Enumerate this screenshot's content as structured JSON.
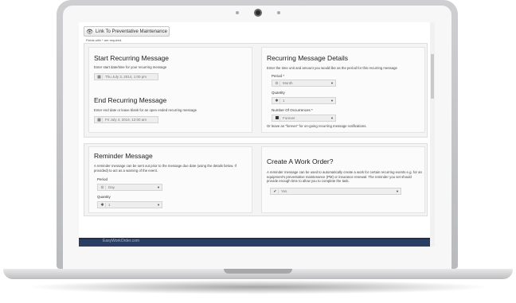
{
  "top_button": {
    "label": "Link To Preventative Maintenance",
    "icon": "eye-icon"
  },
  "required_note": "Fields with * are required.",
  "start": {
    "title": "Start Recurring Message",
    "help": "Enter start date/time for your recurring message",
    "value": "Thu July 3, 2014, 1:00 pm"
  },
  "end": {
    "title": "End Recurring Message",
    "help": "Enter end date or leave blank for an open ended recurring message",
    "value": "Fri July 4, 2014, 12:00 am"
  },
  "details": {
    "title": "Recurring Message Details",
    "help": "Enter the time unit and amount you would like as the period for this recurring message",
    "period_label": "Period *",
    "period_value": "Month",
    "quantity_label": "Quantity",
    "quantity_value": "1",
    "occurrences_label": "Number Of Occurrences *",
    "occurrences_value": "Forever",
    "occurrences_help": "Or leave as \"forever\" for on-going recurring message notifications."
  },
  "reminder": {
    "title": "Reminder Message",
    "help": "A reminder message can be sent out prior to the message due date (using the details below. If provided) to act as a warning of the event.",
    "period_label": "Period",
    "period_value": "Day",
    "quantity_label": "Quantity",
    "quantity_value": "1"
  },
  "workorder": {
    "title": "Create A Work Order?",
    "help": "A reminder message can be used to automatically create a work for certain recurring events e.g. for an equipment's preventative maintenance (PM) or insurance renewal. The reminder you set should provide enough time to allow you to complete the task.",
    "value": "Yes"
  },
  "footer": {
    "text": "EasyWorkOrder.com"
  },
  "colors": {
    "footer": "#2a3e63",
    "panel": "#f4f4f4"
  }
}
